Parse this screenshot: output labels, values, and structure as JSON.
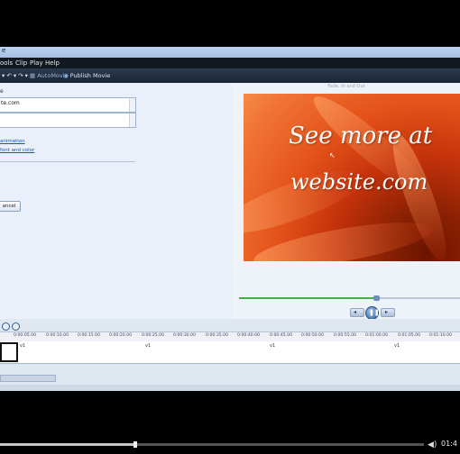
{
  "window": {
    "title": "e"
  },
  "menu": {
    "items": [
      "ools",
      "Clip",
      "Play",
      "Help"
    ]
  },
  "toolbar": {
    "undo_redo": "▾ ↶ ▾ ↷ ▾",
    "automovie_label": "AutoMovie",
    "publish_label": "Publish Movie"
  },
  "editor": {
    "heading": "e",
    "text_value": "te.com",
    "link_animation": "animation",
    "link_font": "font and color",
    "cancel_label": "ancel"
  },
  "preview": {
    "title": "Fade, In and Out",
    "line1": "See more at",
    "line2": "website.com",
    "seek_progress": 0.62
  },
  "timeline": {
    "ticks": [
      "0:00:05.00",
      "0:00:10.00",
      "0:00:15.00",
      "0:00:20.00",
      "0:00:25.00",
      "0:00:30.00",
      "0:00:35.00",
      "0:00:40.00",
      "0:00:45.00",
      "0:00:50.00",
      "0:00:55.00",
      "0:01:00.00",
      "0:01:05.00",
      "0:01:10.00"
    ],
    "track_labels": [
      "v1",
      "v1",
      "v1",
      "v1"
    ]
  },
  "player": {
    "progress": 0.32,
    "time": "01:4"
  }
}
